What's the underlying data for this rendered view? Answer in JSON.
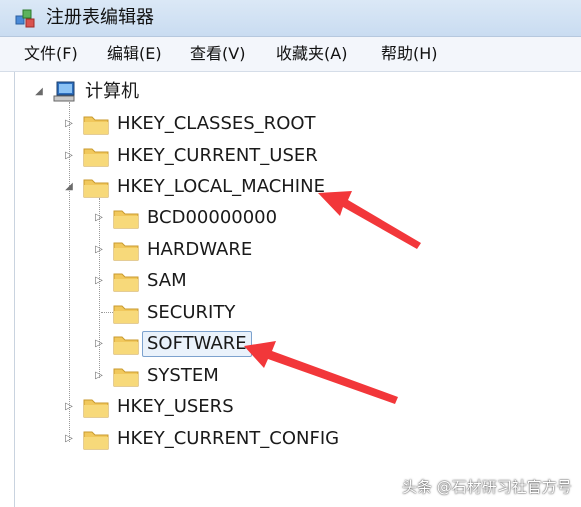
{
  "window": {
    "title": "注册表编辑器"
  },
  "menu": [
    "文件(F)",
    "编辑(E)",
    "查看(V)",
    "收藏夹(A)",
    "帮助(H)"
  ],
  "tree": {
    "root": "计算机",
    "hives": {
      "classes_root": "HKEY_CLASSES_ROOT",
      "current_user": "HKEY_CURRENT_USER",
      "local_machine": "HKEY_LOCAL_MACHINE",
      "users": "HKEY_USERS",
      "current_config": "HKEY_CURRENT_CONFIG"
    },
    "local_machine_children": [
      "BCD00000000",
      "HARDWARE",
      "SAM",
      "SECURITY",
      "SOFTWARE",
      "SYSTEM"
    ]
  },
  "watermark": "头条 @石材研习社官方号",
  "colors": {
    "arrow": "#f2373a",
    "folder": "#f1c85c",
    "selection_border": "#7da2ce"
  }
}
